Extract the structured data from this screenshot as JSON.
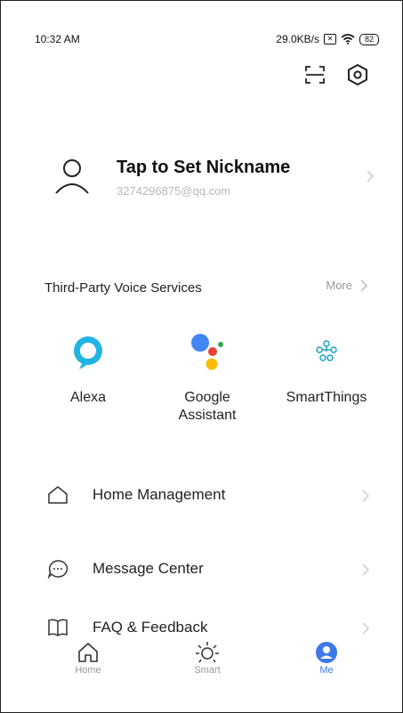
{
  "status_bar": {
    "time": "10:32 AM",
    "speed": "29.0KB/s",
    "battery": "82"
  },
  "profile": {
    "nickname": "Tap to Set Nickname",
    "email": "3274296875@qq.com"
  },
  "voice_services": {
    "title": "Third-Party Voice Services",
    "more_label": "More",
    "items": [
      {
        "label": "Alexa",
        "icon": "alexa-icon"
      },
      {
        "label": "Google\nAssistant",
        "icon": "google-assistant-icon"
      },
      {
        "label": "SmartThings",
        "icon": "smartthings-icon"
      }
    ]
  },
  "menu": [
    {
      "label": "Home Management",
      "icon": "house-outline-icon"
    },
    {
      "label": "Message Center",
      "icon": "chat-bubble-icon"
    },
    {
      "label": "FAQ & Feedback",
      "icon": "book-icon"
    }
  ],
  "tabs": [
    {
      "label": "Home",
      "icon": "home-icon"
    },
    {
      "label": "Smart",
      "icon": "sun-icon"
    },
    {
      "label": "Me",
      "icon": "profile-icon",
      "active": true
    }
  ],
  "colors": {
    "accent": "#3f78e8",
    "alexa": "#1fb4e4",
    "google_blue": "#4285f4",
    "google_red": "#ea4335",
    "google_yellow": "#fbbc05",
    "google_green": "#34a853",
    "smartthings": "#15a0c5"
  }
}
